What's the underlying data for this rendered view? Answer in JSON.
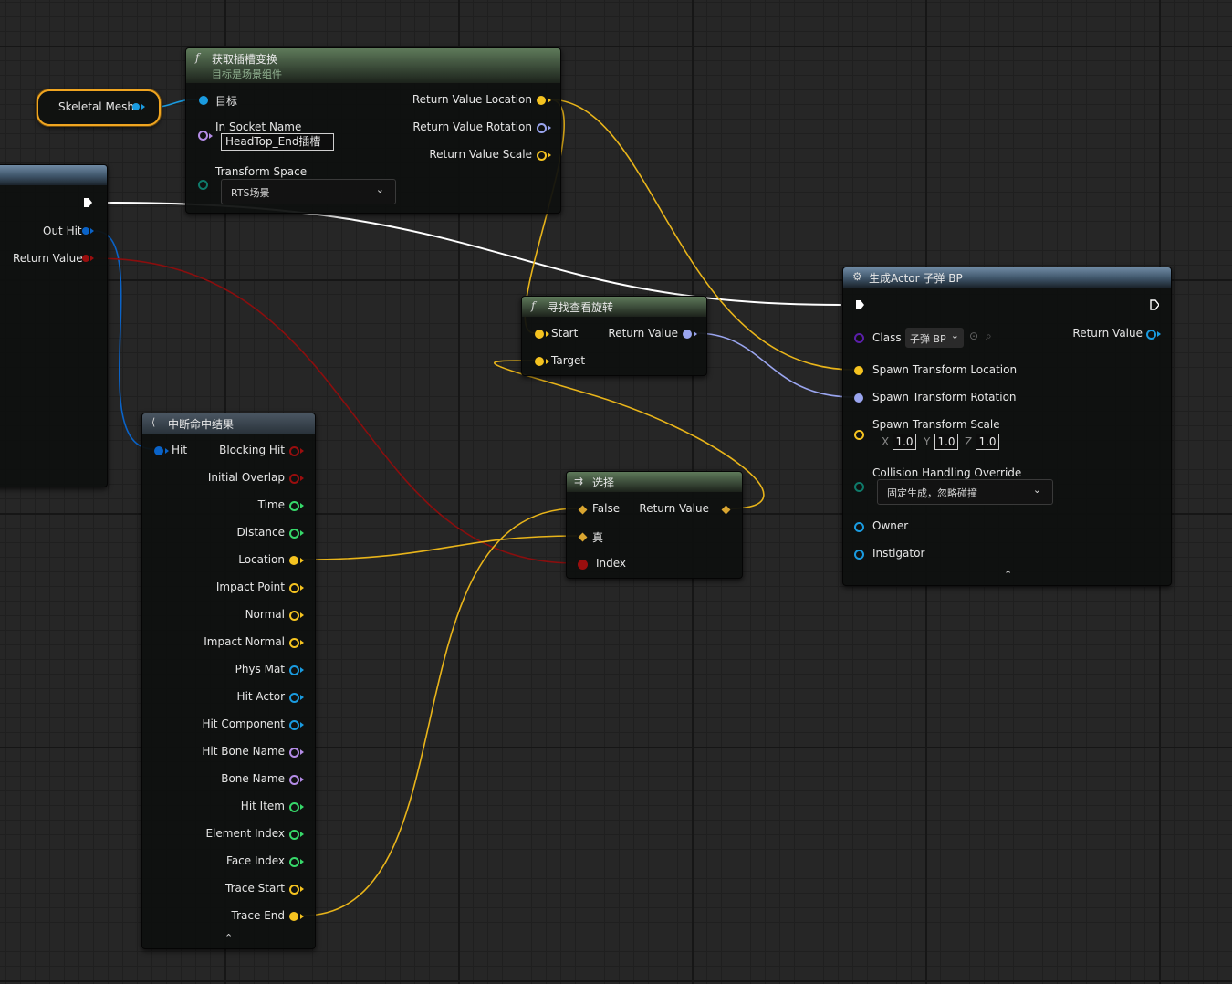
{
  "variable_node": {
    "label": "Skeletal Mesh"
  },
  "get_socket_transform": {
    "title": "获取插槽变换",
    "subtitle": "目标是场景组件",
    "inputs": {
      "target": "目标",
      "socket_name": "In Socket Name",
      "socket_value": "HeadTop_End插槽",
      "transform_space": "Transform Space",
      "transform_space_value": "RTS场景"
    },
    "outputs": {
      "location": "Return Value Location",
      "rotation": "Return Value Rotation",
      "scale": "Return Value Scale"
    }
  },
  "trace_node": {
    "out_hit": "Out Hit",
    "return_value": "Return Value"
  },
  "break_hit": {
    "title": "中断命中结果",
    "input": "Hit",
    "outputs": [
      "Blocking Hit",
      "Initial Overlap",
      "Time",
      "Distance",
      "Location",
      "Impact Point",
      "Normal",
      "Impact Normal",
      "Phys Mat",
      "Hit Actor",
      "Hit Component",
      "Hit Bone Name",
      "Bone Name",
      "Hit Item",
      "Element Index",
      "Face Index",
      "Trace Start",
      "Trace End"
    ],
    "collapse_glyph": "⌃"
  },
  "find_look_at": {
    "title": "寻找查看旋转",
    "start": "Start",
    "target": "Target",
    "return_value": "Return Value"
  },
  "select_node": {
    "title": "选择",
    "false_label": "False",
    "true_label": "真",
    "index_label": "Index",
    "return_value": "Return Value"
  },
  "spawn_actor": {
    "title": "生成Actor 子弹 BP",
    "class_label": "Class",
    "class_value": "子弹 BP",
    "return_value": "Return Value",
    "spawn_location": "Spawn Transform Location",
    "spawn_rotation": "Spawn Transform Rotation",
    "spawn_scale": "Spawn Transform Scale",
    "scale_x_axis": "X",
    "scale_x": "1.0",
    "scale_y_axis": "Y",
    "scale_y": "1.0",
    "scale_z_axis": "Z",
    "scale_z": "1.0",
    "collision_label": "Collision Handling Override",
    "collision_value": "固定生成，忽略碰撞",
    "owner": "Owner",
    "instigator": "Instigator",
    "collapse_glyph": "⌃"
  },
  "colors": {
    "vector_pin": "#f5c320",
    "rotator_pin": "#9aa5ef",
    "object_pin": "#1a9be0",
    "struct_pin": "#0a63c8",
    "bool_pin": "#9a0e0e",
    "float_pin": "#37d86a",
    "name_pin": "#b48ce6",
    "class_pin": "#5a1fa8",
    "exec_pin": "#ffffff",
    "wildcard_pin": "#d9a530"
  }
}
